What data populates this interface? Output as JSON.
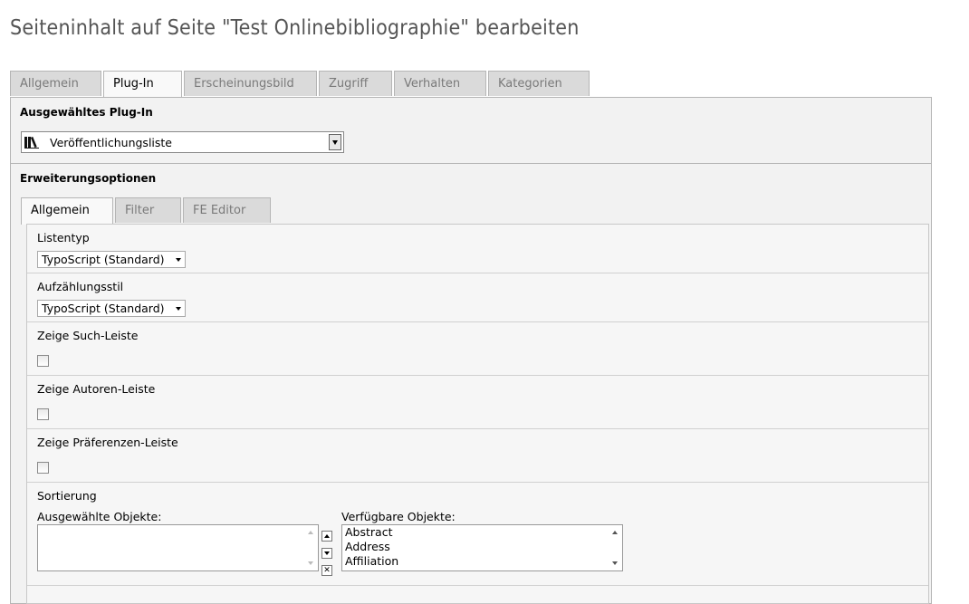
{
  "page": {
    "title": "Seiteninhalt auf Seite \"Test Onlinebibliographie\" bearbeiten"
  },
  "outer_tabs": [
    "Allgemein",
    "Plug-In",
    "Erscheinungsbild",
    "Zugriff",
    "Verhalten",
    "Kategorien"
  ],
  "outer_active_tab": "Plug-In",
  "plugin_section": {
    "label": "Ausgewähltes Plug-In",
    "selected_plugin": "Veröffentlichungsliste",
    "icon": "books-icon"
  },
  "extension_section": {
    "label": "Erweiterungsoptionen"
  },
  "inner_tabs": [
    "Allgemein",
    "Filter",
    "FE Editor"
  ],
  "inner_active_tab": "Allgemein",
  "fields": {
    "listentyp": {
      "label": "Listentyp",
      "value": "TypoScript (Standard)"
    },
    "aufzaehlungsstil": {
      "label": "Aufzählungsstil",
      "value": "TypoScript (Standard)"
    },
    "such_leiste": {
      "label": "Zeige Such-Leiste",
      "checked": false
    },
    "autoren_leiste": {
      "label": "Zeige Autoren-Leiste",
      "checked": false
    },
    "praeferenzen_leiste": {
      "label": "Zeige Präferenzen-Leiste",
      "checked": false
    },
    "sortierung": {
      "label": "Sortierung",
      "selected_label": "Ausgewählte Objekte:",
      "selected_items": [],
      "available_label": "Verfügbare Objekte:",
      "available_items": [
        "Abstract",
        "Address",
        "Affiliation"
      ]
    }
  },
  "colors": {
    "title": "#555555",
    "tab_inactive_bg": "#dadada",
    "tab_active_bg": "#f9f9f9",
    "panel_bg": "#f2f2f2",
    "border": "#b5b5b5"
  }
}
